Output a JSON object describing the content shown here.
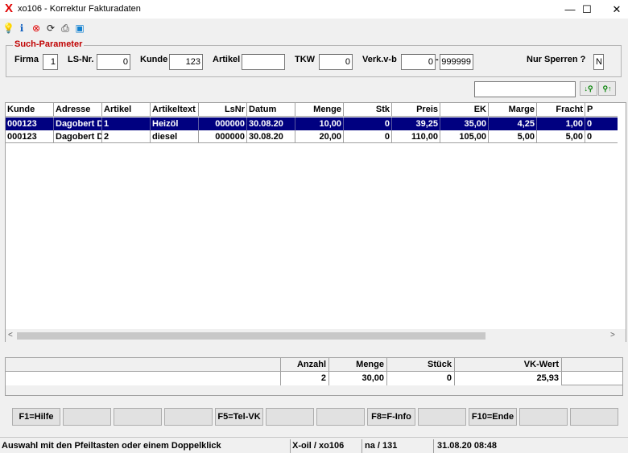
{
  "window": {
    "icon_glyph": "X",
    "title": "xo106 - Korrektur Fakturadaten",
    "minimize": "—",
    "maximize": "☐",
    "close": "✕"
  },
  "toolbar": [
    {
      "icon": "lightbulb-icon",
      "glyph": "💡"
    },
    {
      "icon": "info-icon",
      "glyph": "ℹ"
    },
    {
      "icon": "cancel-icon",
      "glyph": "⊗"
    },
    {
      "icon": "refresh-icon",
      "glyph": "⟳"
    },
    {
      "icon": "print-icon",
      "glyph": "⎙"
    },
    {
      "icon": "calculator-icon",
      "glyph": "▣"
    }
  ],
  "search_params": {
    "title": "Such-Parameter",
    "firma_label": "Firma",
    "firma_value": "1",
    "lsnr_label": "LS-Nr.",
    "lsnr_value": "0",
    "kunde_label": "Kunde",
    "kunde_value": "123",
    "artikel_label": "Artikel",
    "artikel_value": "",
    "tkw_label": "TKW",
    "tkw_value": "0",
    "verk_label": "Verk.v-b",
    "verk_from": "0",
    "verk_sep": "-",
    "verk_to": "999999",
    "sperren_label": "Nur Sperren ?",
    "sperren_value": "N"
  },
  "search": {
    "value": "",
    "find_down": "↓⚲",
    "find_up": "⚲↑"
  },
  "grid": {
    "columns": [
      "Kunde",
      "Adresse",
      "Artikel",
      "Artikeltext",
      "LsNr",
      "Datum",
      "Menge",
      "Stk",
      "Preis",
      "EK",
      "Marge",
      "Fracht",
      "P"
    ],
    "rows": [
      [
        "000123",
        "Dagobert D",
        "1",
        "Heizöl",
        "000000",
        "30.08.20",
        "10,00",
        "0",
        "39,25",
        "35,00",
        "4,25",
        "1,00",
        "0"
      ],
      [
        "000123",
        "Dagobert D",
        "2",
        "diesel",
        "000000",
        "30.08.20",
        "20,00",
        "0",
        "110,00",
        "105,00",
        "5,00",
        "5,00",
        "0"
      ]
    ],
    "scroll_left": "<",
    "scroll_right": ">",
    "scroll_down": "⌄"
  },
  "summary": {
    "headers": [
      "Anzahl",
      "Menge",
      "Stück",
      "VK-Wert"
    ],
    "values": [
      "2",
      "30,00",
      "0",
      "25,93"
    ]
  },
  "fkeys": [
    "F1=Hilfe",
    "",
    "",
    "",
    "F5=Tel-VK",
    "",
    "",
    "F8=F-Info",
    "",
    "F10=Ende",
    "",
    ""
  ],
  "status": {
    "message": "Auswahl mit den Pfeiltasten oder einem Doppelklick",
    "program": "X-oil / xo106",
    "position": "na / 131",
    "datetime": "31.08.20 08:48"
  }
}
